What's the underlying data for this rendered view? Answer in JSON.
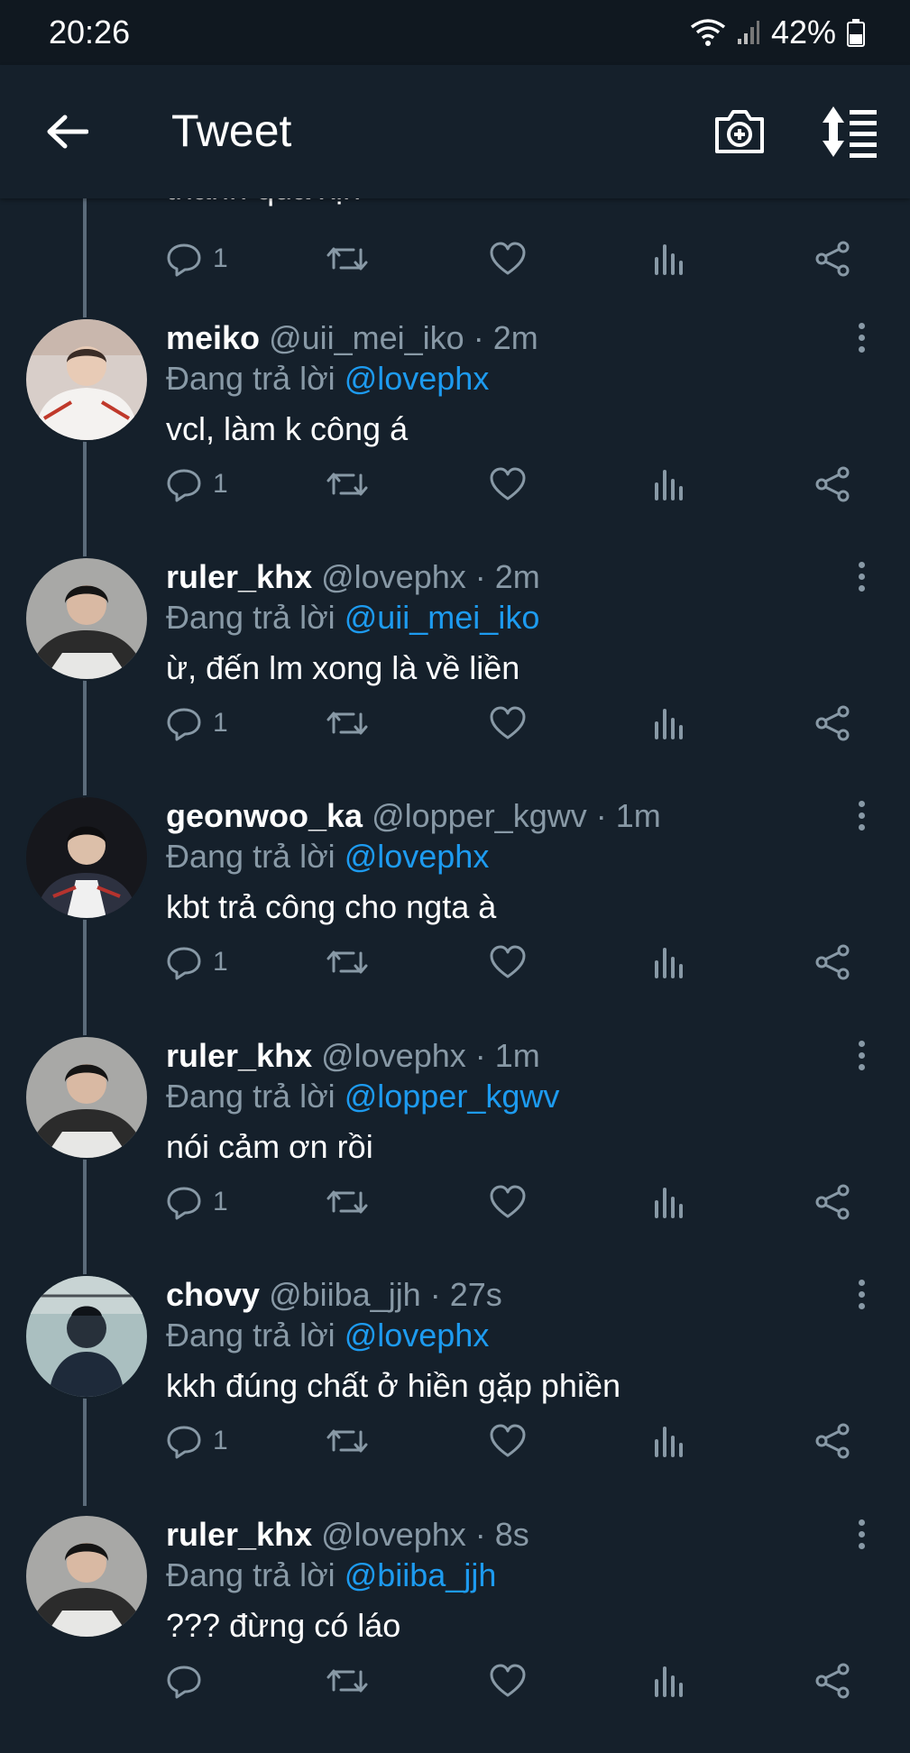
{
  "status_bar": {
    "time": "20:26",
    "battery": "42%"
  },
  "app_bar": {
    "title": "Tweet"
  },
  "partial_tweet": {
    "text": "thành quả xịn",
    "reply_count": "1"
  },
  "reply_label": "Đang trả lời",
  "tweets": [
    {
      "name": "meiko",
      "handle": "@uii_mei_iko",
      "time": "2m",
      "reply_to": "@lovephx",
      "text": "vcl, làm k công á",
      "reply_count": "1",
      "avatar_color": "#e9e2de"
    },
    {
      "name": "ruler_khx",
      "handle": "@lovephx",
      "time": "2m",
      "reply_to": "@uii_mei_iko",
      "text": "ừ, đến lm xong là về liền",
      "reply_count": "1",
      "avatar_color": "#9a9a98"
    },
    {
      "name": "geonwoo_ka",
      "handle": "@lopper_kgwv",
      "time": "1m",
      "reply_to": "@lovephx",
      "text": "kbt trả công cho ngta à",
      "reply_count": "1",
      "avatar_color": "#1b1c22"
    },
    {
      "name": "ruler_khx",
      "handle": "@lovephx",
      "time": "1m",
      "reply_to": "@lopper_kgwv",
      "text": "nói cảm ơn rồi",
      "reply_count": "1",
      "avatar_color": "#9a9a98"
    },
    {
      "name": "chovy",
      "handle": "@biiba_jjh",
      "time": "27s",
      "reply_to": "@lovephx",
      "text": "kkh đúng chất ở hiền gặp phiền",
      "reply_count": "1",
      "avatar_color": "#9fb2b4"
    },
    {
      "name": "ruler_khx",
      "handle": "@lovephx",
      "time": "8s",
      "reply_to": "@biiba_jjh",
      "text": "??? đừng có láo",
      "reply_count": "",
      "avatar_color": "#9a9a98"
    }
  ],
  "colors": {
    "background": "#15202b",
    "accent": "#1d9bf0",
    "muted": "#8899a6"
  },
  "icons": [
    "back-arrow-icon",
    "camera-add-icon",
    "sort-icon",
    "reply-icon",
    "retweet-icon",
    "like-icon",
    "stats-icon",
    "share-icon",
    "more-icon",
    "wifi-icon",
    "signal-icon",
    "battery-icon"
  ]
}
